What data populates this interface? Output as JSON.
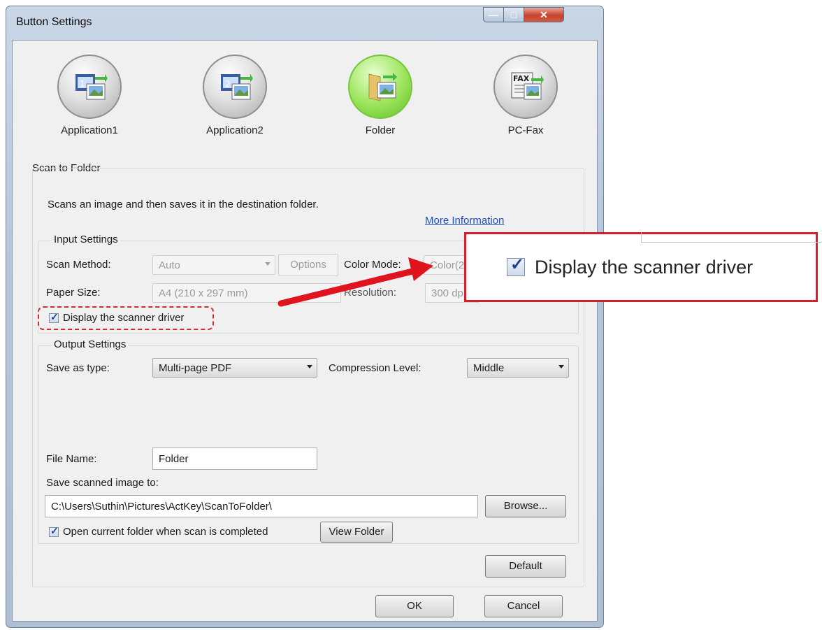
{
  "window": {
    "title": "Button Settings",
    "controls": {
      "minimize": "—",
      "maximize": "□",
      "close": "✕"
    }
  },
  "tools": [
    {
      "label": "Application1",
      "icon": "application1-icon",
      "selected": false
    },
    {
      "label": "Application2",
      "icon": "application2-icon",
      "selected": false
    },
    {
      "label": "Folder",
      "icon": "folder-icon",
      "selected": true
    },
    {
      "label": "PC-Fax",
      "icon": "pc-fax-icon",
      "selected": false
    }
  ],
  "scan_to_folder": {
    "title": "Scan to Folder",
    "description": "Scans an image and then saves it in the destination folder.",
    "more_info_link": "More Information"
  },
  "input_settings": {
    "title": "Input Settings",
    "scan_method_label": "Scan Method:",
    "scan_method_value": "Auto",
    "options_button": "Options",
    "color_mode_label": "Color Mode:",
    "color_mode_value": "Color(2",
    "paper_size_label": "Paper Size:",
    "paper_size_value": "A4 (210 x 297 mm)",
    "resolution_label": "Resolution:",
    "resolution_value": "300 dp",
    "display_driver_label": "Display the scanner driver",
    "display_driver_checked": true
  },
  "output_settings": {
    "title": "Output Settings",
    "save_as_type_label": "Save as type:",
    "save_as_type_value": "Multi-page PDF",
    "compression_label": "Compression Level:",
    "compression_value": "Middle",
    "file_name_label": "File Name:",
    "file_name_value": "Folder",
    "save_to_label": "Save scanned image to:",
    "save_to_value": "C:\\Users\\Suthin\\Pictures\\ActKey\\ScanToFolder\\",
    "browse_button": "Browse...",
    "open_folder_label": "Open current folder when scan is completed",
    "open_folder_checked": true,
    "view_folder_button": "View Folder"
  },
  "buttons": {
    "default": "Default",
    "ok": "OK",
    "cancel": "Cancel"
  },
  "callout": {
    "label": "Display the scanner driver",
    "arrow_color": "#e0141e",
    "border_color": "#d4202a"
  }
}
